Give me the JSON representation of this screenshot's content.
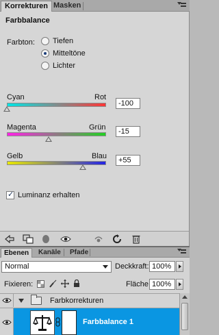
{
  "korrekturen_panel": {
    "tabs": [
      {
        "label": "Korrekturen",
        "active": true
      },
      {
        "label": "Masken",
        "active": false
      }
    ],
    "heading": "Farbbalance",
    "farbton_label": "Farbton:",
    "tone_options": [
      {
        "label": "Tiefen",
        "checked": false
      },
      {
        "label": "Mitteltöne",
        "checked": true
      },
      {
        "label": "Lichter",
        "checked": false
      }
    ],
    "sliders": [
      {
        "left_label": "Cyan",
        "right_label": "Rot",
        "value": "-100",
        "colors": [
          "#00e5e5",
          "#ff3535"
        ]
      },
      {
        "left_label": "Magenta",
        "right_label": "Grün",
        "value": "-15",
        "colors": [
          "#ff21e6",
          "#22d122"
        ]
      },
      {
        "left_label": "Gelb",
        "right_label": "Blau",
        "value": "+55",
        "colors": [
          "#e8e800",
          "#2424e6"
        ]
      }
    ],
    "luminance_label": "Luminanz erhalten",
    "luminance_checked": true,
    "toolbar_icons": [
      "back-arrow-icon",
      "clip-to-layer-icon",
      "visibility-eye-icon",
      "previous-state-icon",
      "reset-icon",
      "trash-icon"
    ]
  },
  "ebenen_panel": {
    "tabs": [
      {
        "label": "Ebenen",
        "active": true
      },
      {
        "label": "Kanäle",
        "active": false
      },
      {
        "label": "Pfade",
        "active": false
      }
    ],
    "blend_mode": "Normal",
    "opacity_label": "Deckkraft:",
    "opacity_value": "100%",
    "lock_label": "Fixieren:",
    "fill_label": "Fläche:",
    "fill_value": "100%",
    "layers": [
      {
        "name": "Farbkorrekturen",
        "type": "group",
        "visible": true,
        "expanded": true
      },
      {
        "name": "Farbbalance 1",
        "type": "adjustment",
        "visible": true,
        "selected": true
      }
    ],
    "selection_color": "#0a96e2"
  }
}
